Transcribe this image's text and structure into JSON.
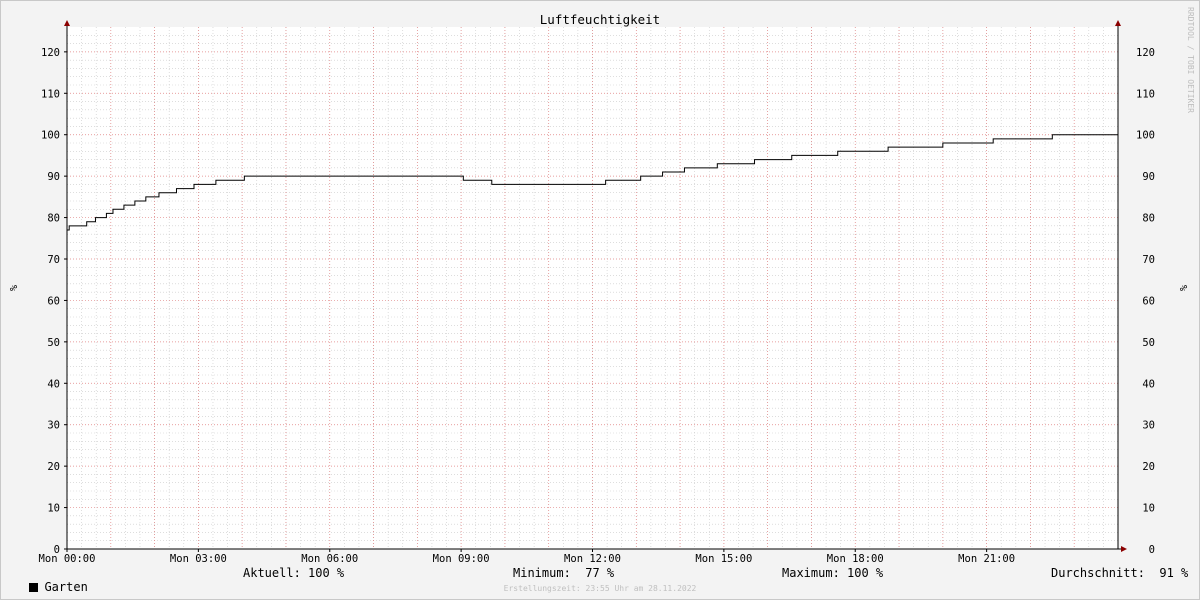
{
  "chart_data": {
    "type": "line",
    "title": "Luftfeuchtigkeit",
    "ylabel_left": "%",
    "ylabel_right": "%",
    "ylim": [
      0,
      126
    ],
    "yticks": [
      0,
      10,
      20,
      30,
      40,
      50,
      60,
      70,
      80,
      90,
      100,
      110,
      120
    ],
    "xlim_hours": [
      0,
      24
    ],
    "xticks": [
      {
        "h": 0,
        "label": "Mon 00:00"
      },
      {
        "h": 3,
        "label": "Mon 03:00"
      },
      {
        "h": 6,
        "label": "Mon 06:00"
      },
      {
        "h": 9,
        "label": "Mon 09:00"
      },
      {
        "h": 12,
        "label": "Mon 12:00"
      },
      {
        "h": 15,
        "label": "Mon 15:00"
      },
      {
        "h": 18,
        "label": "Mon 18:00"
      },
      {
        "h": 21,
        "label": "Mon 21:00"
      }
    ],
    "grid": true,
    "series": [
      {
        "name": "Garten",
        "color": "#000000",
        "step_points": [
          {
            "h": 0.0,
            "v": 77
          },
          {
            "h": 0.05,
            "v": 78
          },
          {
            "h": 0.45,
            "v": 79
          },
          {
            "h": 0.65,
            "v": 80
          },
          {
            "h": 0.9,
            "v": 81
          },
          {
            "h": 1.05,
            "v": 82
          },
          {
            "h": 1.3,
            "v": 83
          },
          {
            "h": 1.55,
            "v": 84
          },
          {
            "h": 1.8,
            "v": 85
          },
          {
            "h": 2.1,
            "v": 86
          },
          {
            "h": 2.5,
            "v": 87
          },
          {
            "h": 2.9,
            "v": 88
          },
          {
            "h": 3.4,
            "v": 89
          },
          {
            "h": 4.05,
            "v": 90
          },
          {
            "h": 9.05,
            "v": 89
          },
          {
            "h": 9.7,
            "v": 88
          },
          {
            "h": 12.3,
            "v": 89
          },
          {
            "h": 13.1,
            "v": 90
          },
          {
            "h": 13.6,
            "v": 91
          },
          {
            "h": 14.1,
            "v": 92
          },
          {
            "h": 14.85,
            "v": 93
          },
          {
            "h": 15.7,
            "v": 94
          },
          {
            "h": 16.55,
            "v": 95
          },
          {
            "h": 17.6,
            "v": 96
          },
          {
            "h": 18.75,
            "v": 97
          },
          {
            "h": 20.0,
            "v": 98
          },
          {
            "h": 21.15,
            "v": 99
          },
          {
            "h": 22.5,
            "v": 100
          },
          {
            "h": 24.0,
            "v": 100
          }
        ]
      }
    ]
  },
  "legend": {
    "series_name": "Garten",
    "aktuell": "Aktuell: 100 %",
    "minimum": "Minimum:  77 %",
    "maximum": "Maximum: 100 %",
    "durchschnitt": "Durchschnitt:  91 %"
  },
  "watermark": "RRDTOOL / TOBI OETIKER",
  "footer": "Erstellungszeit: 23:55 Uhr am 28.11.2022"
}
